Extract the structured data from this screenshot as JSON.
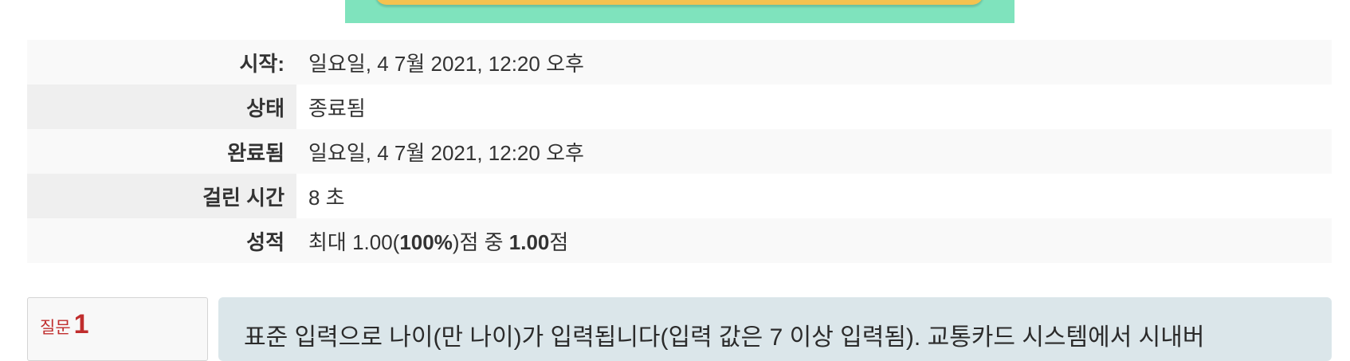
{
  "summary": {
    "rows": [
      {
        "label": "시작:",
        "value": "일요일, 4 7월 2021, 12:20 오후"
      },
      {
        "label": "상태",
        "value": "종료됨"
      },
      {
        "label": "완료됨",
        "value": "일요일, 4 7월 2021, 12:20 오후"
      },
      {
        "label": "걸린 시간",
        "value": "8 초"
      },
      {
        "label": "성적",
        "value_prefix": "최대 1.00(",
        "value_bold1": "100%",
        "value_mid": ")점 중 ",
        "value_bold2": "1.00",
        "value_suffix": "점"
      }
    ]
  },
  "question": {
    "label_word": "질문",
    "number": "1",
    "text": "표준 입력으로 나이(만 나이)가 입력됩니다(입력 값은 7 이상 입력됨). 교통카드 시스템에서 시내버"
  },
  "colors": {
    "banner_bg": "#7fe3bd",
    "banner_bar": "#f5c24f",
    "question_number": "#c02d2d",
    "question_text_bg": "#dbe6ea"
  }
}
